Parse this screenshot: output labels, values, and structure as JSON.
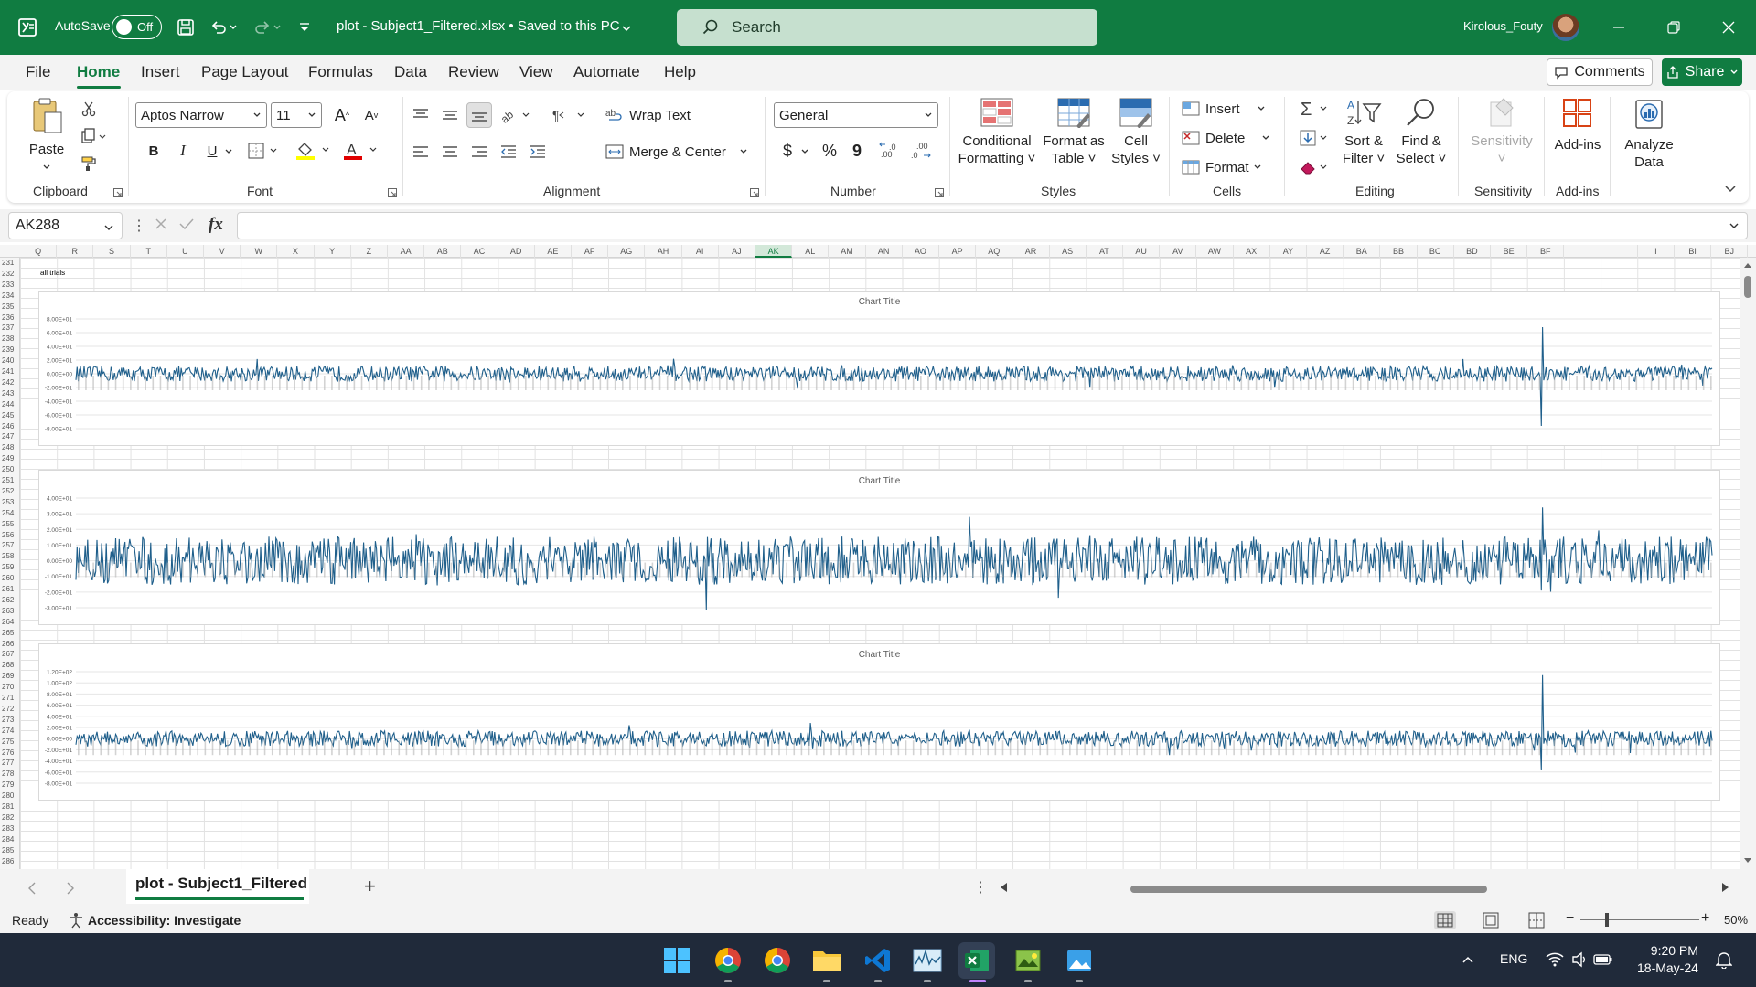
{
  "titlebar": {
    "autosave_label": "AutoSave",
    "autosave_state": "Off",
    "document_title": "plot - Subject1_Filtered.xlsx • Saved to this PC",
    "search_placeholder": "Search",
    "user_name": "Kirolous_Fouty"
  },
  "menu": {
    "items": [
      "File",
      "Home",
      "Insert",
      "Page Layout",
      "Formulas",
      "Data",
      "Review",
      "View",
      "Automate",
      "Help"
    ],
    "active": "Home",
    "comments_label": "Comments",
    "share_label": "Share"
  },
  "ribbon": {
    "clipboard": {
      "paste": "Paste",
      "label": "Clipboard"
    },
    "font": {
      "family": "Aptos Narrow",
      "size": "11",
      "bold": "B",
      "italic": "I",
      "underline": "U",
      "label": "Font"
    },
    "alignment": {
      "wrap_text": "Wrap Text",
      "merge_center": "Merge & Center",
      "label": "Alignment"
    },
    "number": {
      "format": "General",
      "currency": "$",
      "percent": "%",
      "comma": "9",
      "label": "Number"
    },
    "styles": {
      "conditional_1": "Conditional",
      "conditional_2": "Formatting",
      "format_table_1": "Format as",
      "format_table_2": "Table",
      "cell_styles_1": "Cell",
      "cell_styles_2": "Styles",
      "label": "Styles"
    },
    "cells": {
      "insert": "Insert",
      "delete": "Delete",
      "format": "Format",
      "label": "Cells"
    },
    "editing": {
      "sort_1": "Sort &",
      "sort_2": "Filter",
      "find_1": "Find &",
      "find_2": "Select",
      "label": "Editing"
    },
    "sensitivity": {
      "button": "Sensitivity",
      "label": "Sensitivity"
    },
    "addins": {
      "button": "Add-ins",
      "label": "Add-ins"
    },
    "analyze": {
      "line1": "Analyze",
      "line2": "Data"
    }
  },
  "formula_bar": {
    "name_box": "AK288",
    "fx": "fx",
    "content": ""
  },
  "grid": {
    "columns": [
      "Q",
      "R",
      "S",
      "T",
      "U",
      "V",
      "W",
      "X",
      "Y",
      "Z",
      "AA",
      "AB",
      "AC",
      "AD",
      "AE",
      "AF",
      "AG",
      "AH",
      "AI",
      "AJ",
      "AK",
      "AL",
      "AM",
      "AN",
      "AO",
      "AP",
      "AQ",
      "AR",
      "AS",
      "AT",
      "AU",
      "AV",
      "AW",
      "AX",
      "AY",
      "AZ",
      "BA",
      "BB",
      "BC",
      "BD",
      "BE",
      "BF",
      "",
      "",
      "I",
      "BI",
      "BJ"
    ],
    "selected_column": "AK",
    "row_start": 231,
    "row_end": 286,
    "cell_text": "all trials"
  },
  "charts": [
    {
      "title": "Chart Title",
      "y_ticks": [
        "8.00E+01",
        "6.00E+01",
        "4.00E+01",
        "2.00E+01",
        "0.00E+00",
        "-2.00E+01",
        "-4.00E+01",
        "-6.00E+01",
        "-8.00E+01"
      ],
      "ylim": [
        -80,
        80
      ],
      "color": "#1f5f8b"
    },
    {
      "title": "Chart Title",
      "y_ticks": [
        "4.00E+01",
        "3.00E+01",
        "2.00E+01",
        "1.00E+01",
        "0.00E+00",
        "-1.00E+01",
        "-2.00E+01",
        "-3.00E+01"
      ],
      "ylim": [
        -30,
        40
      ],
      "color": "#1f5f8b"
    },
    {
      "title": "Chart Title",
      "y_ticks": [
        "1.20E+02",
        "1.00E+02",
        "8.00E+01",
        "6.00E+01",
        "4.00E+01",
        "2.00E+01",
        "0.00E+00",
        "-2.00E+01",
        "-4.00E+01",
        "-6.00E+01",
        "-8.00E+01"
      ],
      "ylim": [
        -80,
        120
      ],
      "color": "#1f5f8b"
    }
  ],
  "sheets": {
    "active_tab": "plot - Subject1_Filtered",
    "add_label": "+"
  },
  "status": {
    "ready": "Ready",
    "accessibility": "Accessibility: Investigate",
    "zoom": "50%"
  },
  "taskbar": {
    "language": "ENG",
    "time": "9:20 PM",
    "date": "18-May-24"
  },
  "colors": {
    "excel_green": "#107c41",
    "series": "#1f5f8b"
  }
}
